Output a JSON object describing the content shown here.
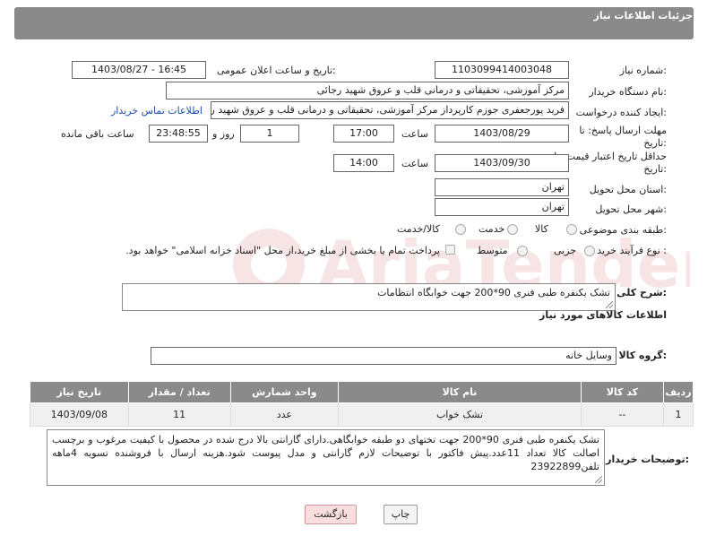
{
  "header": {
    "title": "جزئیات اطلاعات نیاز"
  },
  "form": {
    "need_number": {
      "label": "شماره نیاز:",
      "value": "1103099414003048"
    },
    "announce_datetime": {
      "label": "تاریخ و ساعت اعلان عمومی:",
      "value": "1403/08/27 - 16:45"
    },
    "buyer_org": {
      "label": "نام دستگاه خریدار:",
      "value": "مرکز آموزشی، تحقیقاتی و درمانی قلب و عروق شهید رجائی"
    },
    "requester": {
      "label": "ایجاد کننده درخواست:",
      "value": "فرید پورجعفری جوزم کارپرداز  مرکز آموزشی، تحقیقاتی و درمانی قلب و عروق شهید رجائی",
      "contact_link": "اطلاعات تماس خریدار"
    },
    "reply_deadline": {
      "label_line1": "مهلت ارسال پاسخ: تا",
      "label_line2": "تاریخ:",
      "date": "1403/08/29",
      "time_label": "ساعت",
      "time": "17:00",
      "days": "1",
      "days_label": "روز و",
      "remaining": "23:48:55",
      "remaining_label": "ساعت باقی مانده"
    },
    "price_validity": {
      "label_line1": "حداقل تاریخ اعتبار قیمت: تا",
      "label_line2": "تاریخ:",
      "date": "1403/09/30",
      "time_label": "ساعت",
      "time": "14:00"
    },
    "province": {
      "label": "استان محل تحویل:",
      "value": "تهران"
    },
    "city": {
      "label": "شهر محل تحویل:",
      "value": "تهران"
    },
    "category": {
      "label": "طبقه بندی موضوعی:",
      "options": [
        "کالا",
        "خدمت",
        "کالا/خدمت"
      ]
    },
    "purchase_type": {
      "label": "نوع فرآیند خرید :",
      "options": [
        "جزیی",
        "متوسط"
      ],
      "note": "پرداخت تمام یا بخشی از مبلغ خرید،از محل \"اسناد خزانه اسلامی\" خواهد بود."
    },
    "description": {
      "label": "شرح کلی نیاز:",
      "value": "تشک یکنفره طبی فنری 90*200 جهت خوابگاه انتظامات"
    }
  },
  "goods_section": {
    "title": "اطلاعات کالاهای مورد نیاز",
    "group_label": "گروه کالا:",
    "group_value": "وسایل خانه"
  },
  "table": {
    "headers": [
      "ردیف",
      "کد کالا",
      "نام کالا",
      "واحد شمارش",
      "تعداد / مقدار",
      "تاریخ نیاز"
    ],
    "rows": [
      [
        "1",
        "--",
        "تشک خواب",
        "عدد",
        "11",
        "1403/09/08"
      ]
    ]
  },
  "buyer_notes": {
    "label": "توضیحات خریدار:",
    "value": "تشک یکنفره طبی فنری 90*200 جهت تختهای دو طبقه خوابگاهی.دارای گارانتی بالا درج شده در محصول با کیفیت مرغوب و برچسب اصالت کالا تعداد 11عدد.پیش فاکتور با توضیحات لازم گارانتی و مدل پیوست شود.هزینه ارسال با فروشنده تسویه 4ماهه تلفن23922899"
  },
  "buttons": {
    "print": "چاپ",
    "back": "بازگشت"
  },
  "watermark": {
    "text": "AriaTender.neT"
  }
}
